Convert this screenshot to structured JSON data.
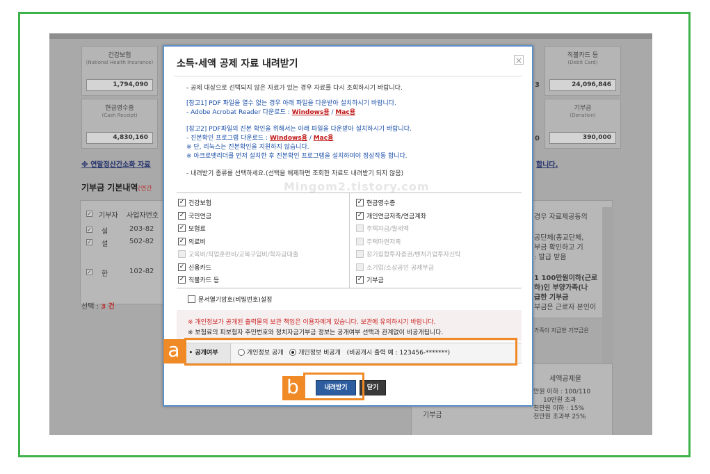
{
  "background": {
    "stats_row1": [
      {
        "title": "건강보험",
        "sub": "(National Health Insurance)",
        "value": "1,794,090"
      },
      {
        "title": "직불카드 등",
        "sub": "(Debit Card)",
        "value": "24,096,846"
      }
    ],
    "stats_row2": [
      {
        "title": "현금영수증",
        "sub": "(Cash Receipt)",
        "value": "4,830,160"
      },
      {
        "title": "기부금",
        "sub": "(Donation)",
        "value": "390,000"
      }
    ],
    "partial_digit_1": "3",
    "partial_digit_2": "0",
    "link_left": "※ 연말정산간소화 자료",
    "link_right": "합니다.",
    "section_title": "기부금 기본내역",
    "section_title_sub": "(연간",
    "table_headers": [
      "기부자",
      "사업자번호"
    ],
    "table_rows": [
      {
        "name": "설",
        "id": "203-82"
      },
      {
        "name": "설",
        "id": "502-82"
      },
      {
        "name": "한",
        "id": "102-82"
      }
    ],
    "selected_label": "선택 : ",
    "selected_count": "3 건",
    "right_texts": [
      "경우 자료제공동의",
      "공단체(종교단체,",
      "부금 확인하고 기",
      ": 발급 받음",
      "1 100만원이하(근로",
      "하)인 부양가족(나",
      "급한 기부금",
      "부금은 근로자 본인이",
      "가족이 지급한 기부금은"
    ],
    "bottom_header": "세액공제율",
    "bottom_label": "기부금",
    "bottom_texts": [
      "만원 이하 : 100/110",
      "10만원 초과",
      "천만원 이하 : 15%",
      "천만원 초과부 25%"
    ]
  },
  "modal": {
    "title": "소득·세액 공제 자료 내려받기",
    "notice_top": "- 공제 대상으로 선택되지 않은 자료가 있는 경우 자료를 다시 조회하시기 바랍니다.",
    "ref1_line1": "[참고1] PDF 파일을 열수 없는 경우  아래 파일을 다운받아 설치하시기 바랍니다.",
    "ref1_line2_prefix": "- Adobe Acrobat Reader 다운로드 : ",
    "ref1_windows": "Windows용",
    "ref1_sep": " / ",
    "ref1_mac": "Mac용",
    "ref2_line1": "[참고2] PDF파일의 진본 확인을 위해서는 아래 파일을 다운받아 설치하시기 바랍니다.",
    "ref2_line2_prefix": "- 진본확인 프로그램 다운로드 : ",
    "ref2_windows": "Windows용",
    "ref2_sep": " / ",
    "ref2_mac": "Mac용",
    "ref2_line3": "※ 단, 리눅스는 진본확인을 지원하지 않습니다.",
    "ref2_line4": "※ 아크로뱃리더를 먼저 설치한 후 진본확인 프로그램을 설치하여야 정상작동 합니다.",
    "select_instruction": "- 내려받기 종류를 선택하세요.(선택을 해제하면 조회한 자료도 내려받기 되지 않음)",
    "watermark": "Mingom2.tistory.com",
    "left_items": [
      {
        "label": "건강보험",
        "checked": true,
        "disabled": false
      },
      {
        "label": "국민연금",
        "checked": true,
        "disabled": false
      },
      {
        "label": "보험료",
        "checked": true,
        "disabled": false
      },
      {
        "label": "의료비",
        "checked": true,
        "disabled": false
      },
      {
        "label": "교육비/직업훈련비/교복구입비/학자금대출",
        "checked": false,
        "disabled": true
      },
      {
        "label": "신용카드",
        "checked": true,
        "disabled": false
      },
      {
        "label": "직불카드 등",
        "checked": true,
        "disabled": false
      }
    ],
    "right_items": [
      {
        "label": "현금영수증",
        "checked": true,
        "disabled": false
      },
      {
        "label": "개인연금저축/연금계좌",
        "checked": true,
        "disabled": false
      },
      {
        "label": "주택자금/월세액",
        "checked": false,
        "disabled": true
      },
      {
        "label": "주택마련저축",
        "checked": false,
        "disabled": true
      },
      {
        "label": "장기집합투자증권/벤처기업투자신탁",
        "checked": false,
        "disabled": true
      },
      {
        "label": "소기업/소상공인 공제부금",
        "checked": false,
        "disabled": true
      },
      {
        "label": "기부금",
        "checked": true,
        "disabled": false
      }
    ],
    "password_option": "문서열기암호(비밀번호)설정",
    "warning1": "※ 개인정보가 공개된 출력물의 보관 책임은 이용자에게 있습니다. 보관에 유의하시기 바랍니다.",
    "warning2": "※ 보험료의 피보험자 주민번호와 정치자금기부금 정보는 공개여부 선택과 관계없이 비공개됩니다.",
    "disclosure_label": "• 공개여부",
    "disclosure_public": "개인정보 공개",
    "disclosure_private": "개인정보 비공개",
    "disclosure_example": "(비공개시 출력 예 : 123456-*******)",
    "download_button": "내려받기",
    "close_button": "닫기"
  },
  "annotations": {
    "a": "a",
    "b": "b",
    "accent": "#f08a27",
    "frame_color": "#3db14a"
  }
}
